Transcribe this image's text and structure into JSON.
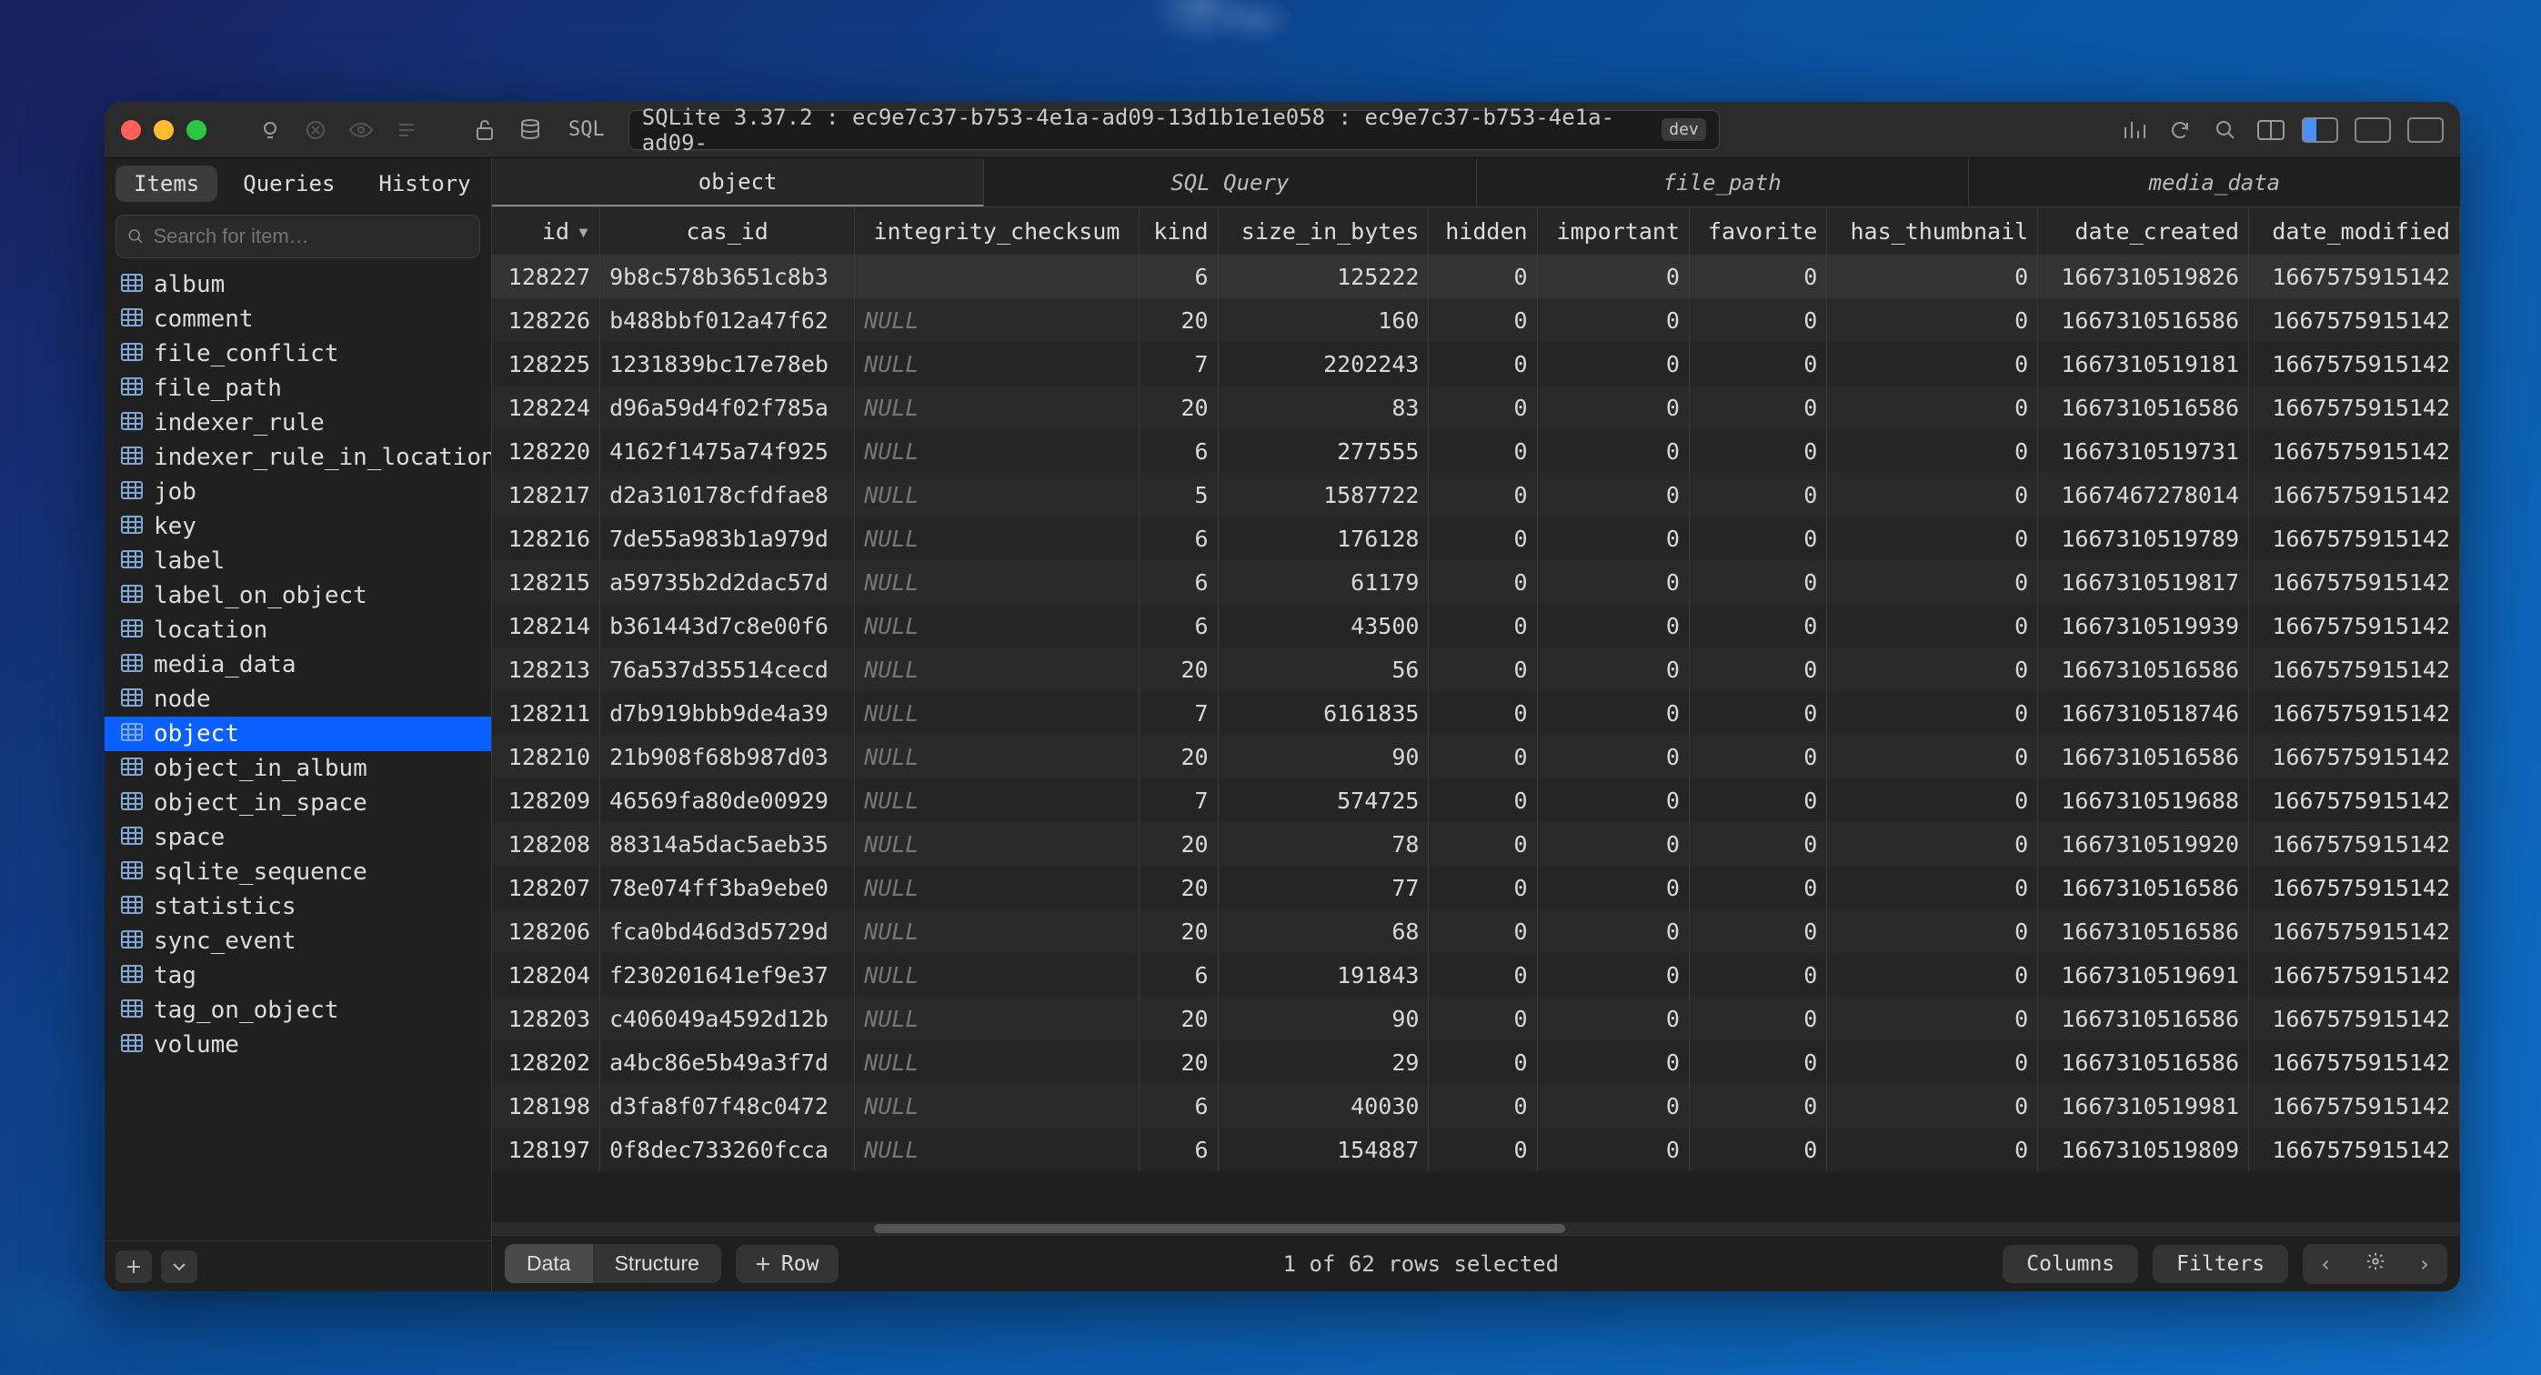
{
  "titlebar": {
    "sql_label": "SQL",
    "path": "SQLite 3.37.2 : ec9e7c37-b753-4e1a-ad09-13d1b1e1e058 : ec9e7c37-b753-4e1a-ad09-",
    "dev_pill": "dev"
  },
  "sidebar": {
    "tabs": {
      "items": "Items",
      "queries": "Queries",
      "history": "History"
    },
    "search_placeholder": "Search for item…",
    "items": [
      "album",
      "comment",
      "file_conflict",
      "file_path",
      "indexer_rule",
      "indexer_rule_in_location",
      "job",
      "key",
      "label",
      "label_on_object",
      "location",
      "media_data",
      "node",
      "object",
      "object_in_album",
      "object_in_space",
      "space",
      "sqlite_sequence",
      "statistics",
      "sync_event",
      "tag",
      "tag_on_object",
      "volume"
    ],
    "selected": "object"
  },
  "top_tabs": [
    "object",
    "SQL Query",
    "file_path",
    "media_data"
  ],
  "top_tab_active": 0,
  "columns": [
    {
      "key": "id",
      "label": "id",
      "align": "right",
      "sortable": true
    },
    {
      "key": "cas_id",
      "label": "cas_id",
      "align": "left"
    },
    {
      "key": "integrity_checksum",
      "label": "integrity_checksum",
      "align": "left"
    },
    {
      "key": "kind",
      "label": "kind",
      "align": "right"
    },
    {
      "key": "size_in_bytes",
      "label": "size_in_bytes",
      "align": "right"
    },
    {
      "key": "hidden",
      "label": "hidden",
      "align": "right"
    },
    {
      "key": "important",
      "label": "important",
      "align": "right"
    },
    {
      "key": "favorite",
      "label": "favorite",
      "align": "right"
    },
    {
      "key": "has_thumbnail",
      "label": "has_thumbnail",
      "align": "right"
    },
    {
      "key": "date_created",
      "label": "date_created",
      "align": "right"
    },
    {
      "key": "date_modified",
      "label": "date_modified",
      "align": "right"
    }
  ],
  "rows": [
    {
      "id": 128227,
      "cas_id": "9b8c578b3651c8b3",
      "integrity_checksum": null,
      "kind": 6,
      "size_in_bytes": 125222,
      "hidden": 0,
      "important": 0,
      "favorite": 0,
      "has_thumbnail": 0,
      "date_created": 1667310519826,
      "date_modified": 1667575915142,
      "selected": true
    },
    {
      "id": 128226,
      "cas_id": "b488bbf012a47f62",
      "integrity_checksum": "NULL",
      "kind": 20,
      "size_in_bytes": 160,
      "hidden": 0,
      "important": 0,
      "favorite": 0,
      "has_thumbnail": 0,
      "date_created": 1667310516586,
      "date_modified": 1667575915142
    },
    {
      "id": 128225,
      "cas_id": "1231839bc17e78eb",
      "integrity_checksum": "NULL",
      "kind": 7,
      "size_in_bytes": 2202243,
      "hidden": 0,
      "important": 0,
      "favorite": 0,
      "has_thumbnail": 0,
      "date_created": 1667310519181,
      "date_modified": 1667575915142
    },
    {
      "id": 128224,
      "cas_id": "d96a59d4f02f785a",
      "integrity_checksum": "NULL",
      "kind": 20,
      "size_in_bytes": 83,
      "hidden": 0,
      "important": 0,
      "favorite": 0,
      "has_thumbnail": 0,
      "date_created": 1667310516586,
      "date_modified": 1667575915142
    },
    {
      "id": 128220,
      "cas_id": "4162f1475a74f925",
      "integrity_checksum": "NULL",
      "kind": 6,
      "size_in_bytes": 277555,
      "hidden": 0,
      "important": 0,
      "favorite": 0,
      "has_thumbnail": 0,
      "date_created": 1667310519731,
      "date_modified": 1667575915142
    },
    {
      "id": 128217,
      "cas_id": "d2a310178cfdfae8",
      "integrity_checksum": "NULL",
      "kind": 5,
      "size_in_bytes": 1587722,
      "hidden": 0,
      "important": 0,
      "favorite": 0,
      "has_thumbnail": 0,
      "date_created": 1667467278014,
      "date_modified": 1667575915142
    },
    {
      "id": 128216,
      "cas_id": "7de55a983b1a979d",
      "integrity_checksum": "NULL",
      "kind": 6,
      "size_in_bytes": 176128,
      "hidden": 0,
      "important": 0,
      "favorite": 0,
      "has_thumbnail": 0,
      "date_created": 1667310519789,
      "date_modified": 1667575915142
    },
    {
      "id": 128215,
      "cas_id": "a59735b2d2dac57d",
      "integrity_checksum": "NULL",
      "kind": 6,
      "size_in_bytes": 61179,
      "hidden": 0,
      "important": 0,
      "favorite": 0,
      "has_thumbnail": 0,
      "date_created": 1667310519817,
      "date_modified": 1667575915142
    },
    {
      "id": 128214,
      "cas_id": "b361443d7c8e00f6",
      "integrity_checksum": "NULL",
      "kind": 6,
      "size_in_bytes": 43500,
      "hidden": 0,
      "important": 0,
      "favorite": 0,
      "has_thumbnail": 0,
      "date_created": 1667310519939,
      "date_modified": 1667575915142
    },
    {
      "id": 128213,
      "cas_id": "76a537d35514cecd",
      "integrity_checksum": "NULL",
      "kind": 20,
      "size_in_bytes": 56,
      "hidden": 0,
      "important": 0,
      "favorite": 0,
      "has_thumbnail": 0,
      "date_created": 1667310516586,
      "date_modified": 1667575915142
    },
    {
      "id": 128211,
      "cas_id": "d7b919bbb9de4a39",
      "integrity_checksum": "NULL",
      "kind": 7,
      "size_in_bytes": 6161835,
      "hidden": 0,
      "important": 0,
      "favorite": 0,
      "has_thumbnail": 0,
      "date_created": 1667310518746,
      "date_modified": 1667575915142
    },
    {
      "id": 128210,
      "cas_id": "21b908f68b987d03",
      "integrity_checksum": "NULL",
      "kind": 20,
      "size_in_bytes": 90,
      "hidden": 0,
      "important": 0,
      "favorite": 0,
      "has_thumbnail": 0,
      "date_created": 1667310516586,
      "date_modified": 1667575915142
    },
    {
      "id": 128209,
      "cas_id": "46569fa80de00929",
      "integrity_checksum": "NULL",
      "kind": 7,
      "size_in_bytes": 574725,
      "hidden": 0,
      "important": 0,
      "favorite": 0,
      "has_thumbnail": 0,
      "date_created": 1667310519688,
      "date_modified": 1667575915142
    },
    {
      "id": 128208,
      "cas_id": "88314a5dac5aeb35",
      "integrity_checksum": "NULL",
      "kind": 20,
      "size_in_bytes": 78,
      "hidden": 0,
      "important": 0,
      "favorite": 0,
      "has_thumbnail": 0,
      "date_created": 1667310519920,
      "date_modified": 1667575915142
    },
    {
      "id": 128207,
      "cas_id": "78e074ff3ba9ebe0",
      "integrity_checksum": "NULL",
      "kind": 20,
      "size_in_bytes": 77,
      "hidden": 0,
      "important": 0,
      "favorite": 0,
      "has_thumbnail": 0,
      "date_created": 1667310516586,
      "date_modified": 1667575915142
    },
    {
      "id": 128206,
      "cas_id": "fca0bd46d3d5729d",
      "integrity_checksum": "NULL",
      "kind": 20,
      "size_in_bytes": 68,
      "hidden": 0,
      "important": 0,
      "favorite": 0,
      "has_thumbnail": 0,
      "date_created": 1667310516586,
      "date_modified": 1667575915142
    },
    {
      "id": 128204,
      "cas_id": "f230201641ef9e37",
      "integrity_checksum": "NULL",
      "kind": 6,
      "size_in_bytes": 191843,
      "hidden": 0,
      "important": 0,
      "favorite": 0,
      "has_thumbnail": 0,
      "date_created": 1667310519691,
      "date_modified": 1667575915142
    },
    {
      "id": 128203,
      "cas_id": "c406049a4592d12b",
      "integrity_checksum": "NULL",
      "kind": 20,
      "size_in_bytes": 90,
      "hidden": 0,
      "important": 0,
      "favorite": 0,
      "has_thumbnail": 0,
      "date_created": 1667310516586,
      "date_modified": 1667575915142
    },
    {
      "id": 128202,
      "cas_id": "a4bc86e5b49a3f7d",
      "integrity_checksum": "NULL",
      "kind": 20,
      "size_in_bytes": 29,
      "hidden": 0,
      "important": 0,
      "favorite": 0,
      "has_thumbnail": 0,
      "date_created": 1667310516586,
      "date_modified": 1667575915142
    },
    {
      "id": 128198,
      "cas_id": "d3fa8f07f48c0472",
      "integrity_checksum": "NULL",
      "kind": 6,
      "size_in_bytes": 40030,
      "hidden": 0,
      "important": 0,
      "favorite": 0,
      "has_thumbnail": 0,
      "date_created": 1667310519981,
      "date_modified": 1667575915142
    },
    {
      "id": 128197,
      "cas_id": "0f8dec733260fcca",
      "integrity_checksum": "NULL",
      "kind": 6,
      "size_in_bytes": 154887,
      "hidden": 0,
      "important": 0,
      "favorite": 0,
      "has_thumbnail": 0,
      "date_created": 1667310519809,
      "date_modified": 1667575915142
    }
  ],
  "footer": {
    "data": "Data",
    "structure": "Structure",
    "row": "Row",
    "status": "1 of 62 rows selected",
    "columns": "Columns",
    "filters": "Filters"
  }
}
